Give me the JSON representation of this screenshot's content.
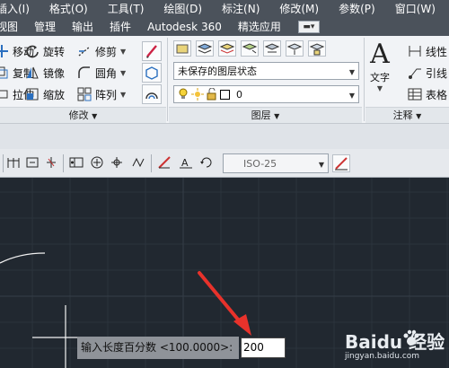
{
  "menubar": {
    "items": [
      "插入(I)",
      "格式(O)",
      "工具(T)",
      "绘图(D)",
      "标注(N)",
      "修改(M)",
      "参数(P)",
      "窗口(W)"
    ]
  },
  "ribbon_tabs": {
    "items": [
      "视图",
      "管理",
      "输出",
      "插件",
      "Autodesk 360",
      "精选应用"
    ]
  },
  "ribbon": {
    "modify": {
      "rows": [
        [
          "移动",
          "旋转",
          "修剪"
        ],
        [
          "复制",
          "镜像",
          "圆角"
        ],
        [
          "拉伸",
          "缩放",
          "阵列"
        ]
      ],
      "title": "修改"
    },
    "layers": {
      "layer_state": "未保存的图层状态",
      "current_layer": "0",
      "title": "图层"
    },
    "annotation": {
      "text_label": "文字",
      "items": [
        "线性",
        "引线",
        "表格"
      ],
      "title": "注释"
    }
  },
  "toolbar2": {
    "dim_style": "ISO-25"
  },
  "command": {
    "prompt": "输入长度百分数 <100.0000>:",
    "input_value": "200"
  },
  "watermark": {
    "brand": "Baidu 经验",
    "url": "jingyan.baidu.com"
  },
  "colors": {
    "menubar_bg": "#4b525b",
    "canvas_bg": "#212830",
    "arrow_red": "#e8322b"
  }
}
